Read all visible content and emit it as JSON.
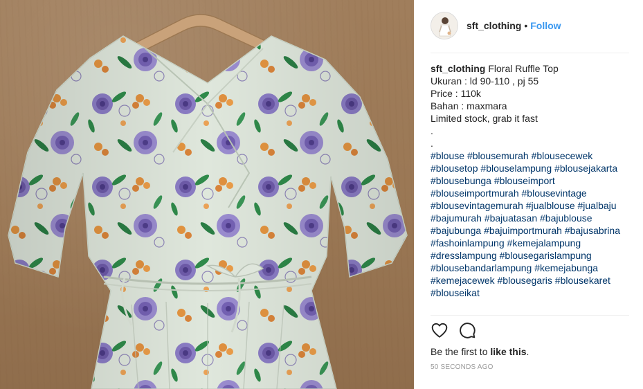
{
  "post": {
    "username": "sft_clothing",
    "dot": "•",
    "follow_label": "Follow",
    "caption": {
      "author": "sft_clothing",
      "title": "Floral Ruffle Top",
      "lines": [
        "Ukuran : ld 90-110 , pj 55",
        "Price : 110k",
        "Bahan : maxmara",
        "Limited stock, grab it fast",
        ".",
        "."
      ],
      "hashtag_lines": [
        [
          "#blouse",
          "#blousemurah",
          "#blousecewek"
        ],
        [
          "#blousetop",
          "#blouselampung",
          "#blousejakarta"
        ],
        [
          "#blousebunga",
          "#blouseimport"
        ],
        [
          "#blouseimportmurah",
          "#blousevintage"
        ],
        [
          "#blousevintagemurah",
          "#jualblouse",
          "#jualbaju"
        ],
        [
          "#bajumurah",
          "#bajuatasan",
          "#bajublouse"
        ],
        [
          "#bajubunga",
          "#bajuimportmurah",
          "#bajusabrina"
        ],
        [
          "#fashoinlampung",
          "#kemejalampung"
        ],
        [
          "#dresslampung",
          "#blousegarislampung"
        ],
        [
          "#blousebandarlampung",
          "#kemejabunga"
        ],
        [
          "#kemejacewek",
          "#blousegaris",
          "#blousekaret"
        ],
        [
          "#blouseikat"
        ]
      ]
    },
    "likes": {
      "prefix": "Be the first to ",
      "link": "like this",
      "suffix": "."
    },
    "timestamp": "50 seconds ago",
    "icons": {
      "like": "heart-icon",
      "comment": "comment-icon"
    },
    "colors": {
      "link_blue": "#3897f0",
      "hashtag": "#003569",
      "text": "#262626",
      "muted": "#999999"
    }
  }
}
